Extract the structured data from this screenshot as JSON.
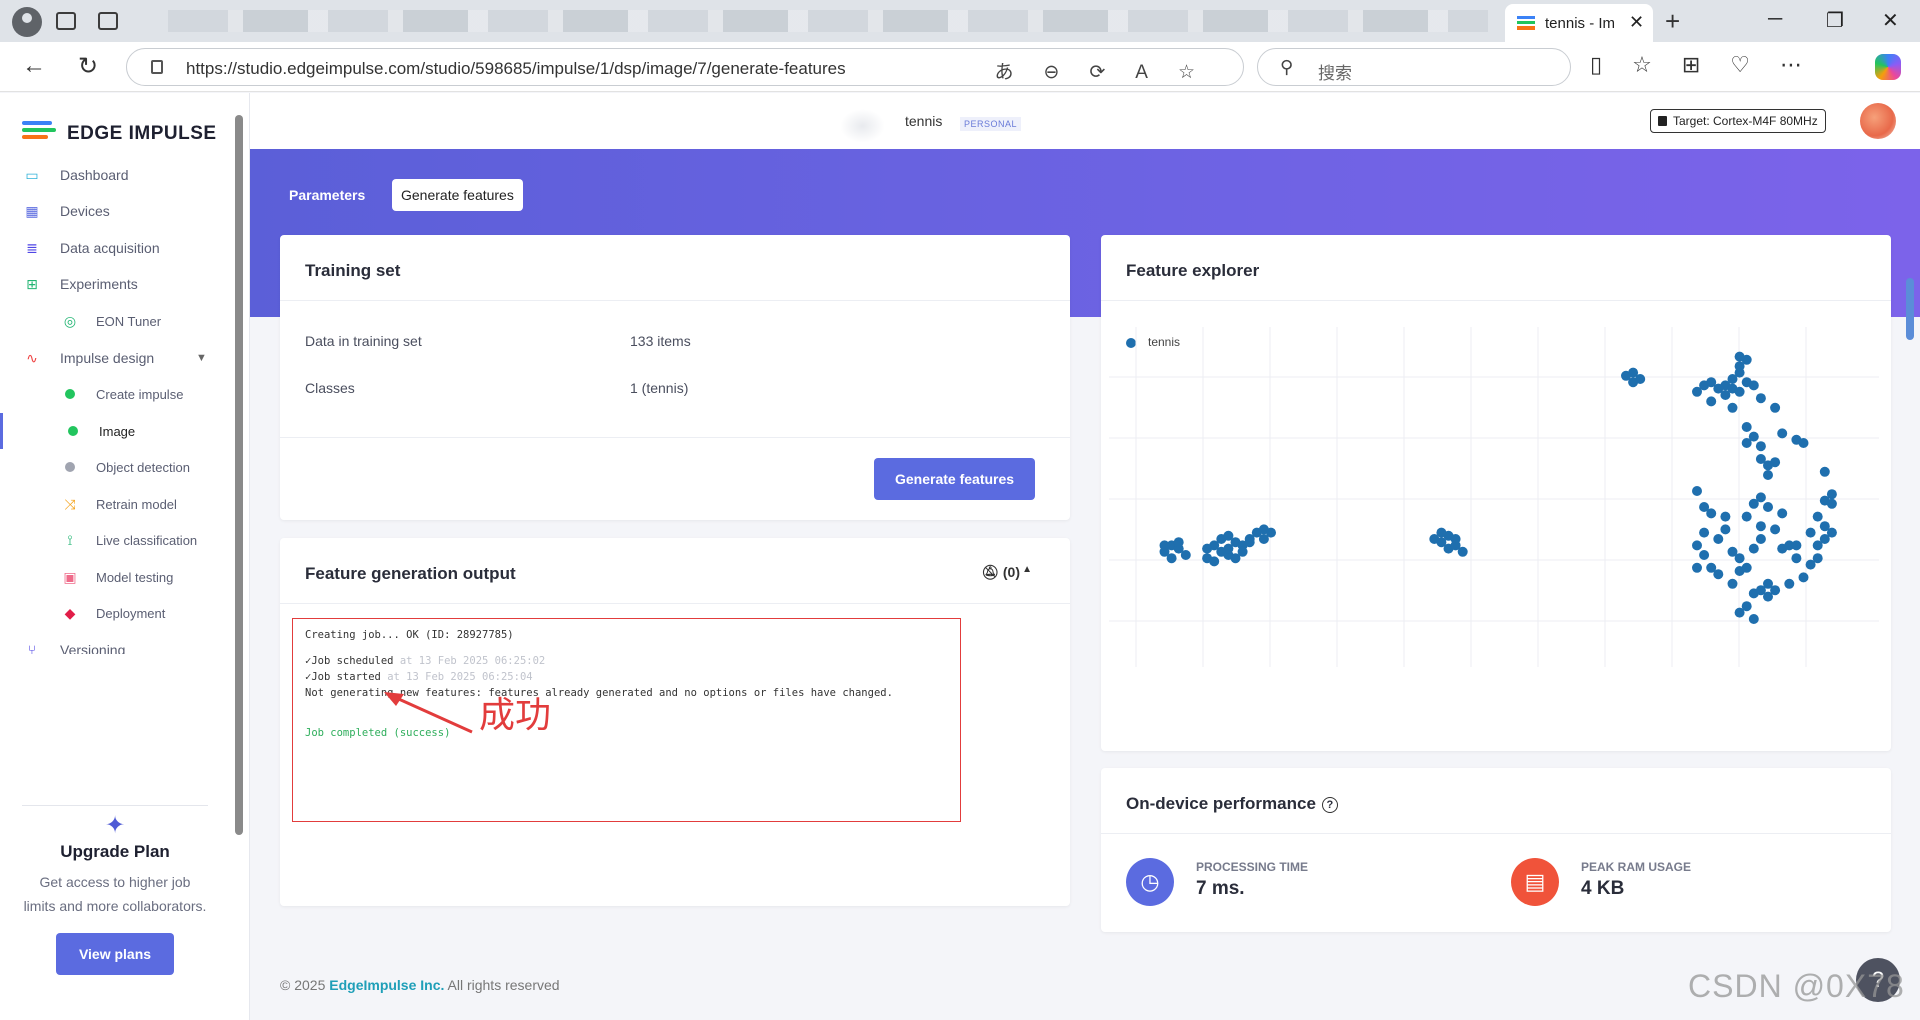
{
  "browser": {
    "active_tab_title": "tennis - Im",
    "url": "https://studio.edgeimpulse.com/studio/598685/impulse/1/dsp/image/7/generate-features",
    "search_placeholder": "搜索"
  },
  "sidebar": {
    "brand": "EDGE IMPULSE",
    "items": [
      {
        "label": "Dashboard",
        "icon": "monitor-icon"
      },
      {
        "label": "Devices",
        "icon": "chip-icon"
      },
      {
        "label": "Data acquisition",
        "icon": "database-icon"
      },
      {
        "label": "Experiments",
        "icon": "table-icon"
      },
      {
        "label": "EON Tuner",
        "icon": "compass-icon"
      },
      {
        "label": "Impulse design",
        "icon": "pulse-icon"
      },
      {
        "label": "Create impulse",
        "icon": "green-dot"
      },
      {
        "label": "Image",
        "icon": "green-dot"
      },
      {
        "label": "Object detection",
        "icon": "gray-dot"
      },
      {
        "label": "Retrain model",
        "icon": "shuffle-icon"
      },
      {
        "label": "Live classification",
        "icon": "classify-icon"
      },
      {
        "label": "Model testing",
        "icon": "flask-icon"
      },
      {
        "label": "Deployment",
        "icon": "box-icon"
      },
      {
        "label": "Versioning",
        "icon": "branch-icon"
      }
    ],
    "upgrade": {
      "title": "Upgrade Plan",
      "description": "Get access to higher job limits and more collaborators.",
      "button": "View plans"
    }
  },
  "topbar": {
    "project_name": "tennis",
    "project_badge": "PERSONAL",
    "target": "Target: Cortex-M4F 80MHz"
  },
  "tabs": {
    "parameters": "Parameters",
    "generate_features": "Generate features"
  },
  "training_set": {
    "title": "Training set",
    "rows": [
      {
        "key": "Data in training set",
        "value": "133 items"
      },
      {
        "key": "Classes",
        "value": "1 (tennis)"
      }
    ],
    "button": "Generate features"
  },
  "output": {
    "title": "Feature generation output",
    "notifications": "(0)",
    "log": {
      "line1": "Creating job... OK (ID: 28927785)",
      "line2_label": "Job scheduled",
      "line2_time": "at 13 Feb 2025 06:25:02",
      "line3_label": "Job started",
      "line3_time": "at 13 Feb 2025 06:25:04",
      "line4": "Not generating new features: features already generated and no options or files have changed.",
      "line5": "Job completed (success)"
    },
    "annotation": "成功"
  },
  "feature_explorer": {
    "title": "Feature explorer",
    "legend": "tennis",
    "color": "#1f6fae"
  },
  "chart_data": {
    "type": "scatter",
    "title": "",
    "xlabel": "",
    "ylabel": "",
    "grid": true,
    "legend_placement": "top-left",
    "series": [
      {
        "name": "tennis",
        "points": [
          [
            0.05,
            0.64
          ],
          [
            0.06,
            0.62
          ],
          [
            0.07,
            0.63
          ],
          [
            0.06,
            0.66
          ],
          [
            0.08,
            0.65
          ],
          [
            0.07,
            0.61
          ],
          [
            0.05,
            0.62
          ],
          [
            0.11,
            0.66
          ],
          [
            0.12,
            0.67
          ],
          [
            0.13,
            0.64
          ],
          [
            0.14,
            0.65
          ],
          [
            0.15,
            0.66
          ],
          [
            0.12,
            0.62
          ],
          [
            0.13,
            0.6
          ],
          [
            0.14,
            0.59
          ],
          [
            0.15,
            0.61
          ],
          [
            0.16,
            0.62
          ],
          [
            0.17,
            0.6
          ],
          [
            0.18,
            0.58
          ],
          [
            0.17,
            0.61
          ],
          [
            0.19,
            0.57
          ],
          [
            0.2,
            0.58
          ],
          [
            0.19,
            0.6
          ],
          [
            0.11,
            0.63
          ],
          [
            0.14,
            0.63
          ],
          [
            0.16,
            0.64
          ],
          [
            0.44,
            0.61
          ],
          [
            0.45,
            0.63
          ],
          [
            0.46,
            0.62
          ],
          [
            0.45,
            0.59
          ],
          [
            0.44,
            0.58
          ],
          [
            0.46,
            0.6
          ],
          [
            0.47,
            0.64
          ],
          [
            0.43,
            0.6
          ],
          [
            0.7,
            0.09
          ],
          [
            0.71,
            0.11
          ],
          [
            0.72,
            0.1
          ],
          [
            0.71,
            0.08
          ],
          [
            0.86,
            0.08
          ],
          [
            0.86,
            0.06
          ],
          [
            0.87,
            0.04
          ],
          [
            0.86,
            0.03
          ],
          [
            0.85,
            0.1
          ],
          [
            0.84,
            0.12
          ],
          [
            0.83,
            0.13
          ],
          [
            0.84,
            0.15
          ],
          [
            0.85,
            0.13
          ],
          [
            0.86,
            0.14
          ],
          [
            0.87,
            0.11
          ],
          [
            0.88,
            0.12
          ],
          [
            0.89,
            0.16
          ],
          [
            0.85,
            0.19
          ],
          [
            0.82,
            0.17
          ],
          [
            0.8,
            0.14
          ],
          [
            0.81,
            0.12
          ],
          [
            0.82,
            0.11
          ],
          [
            0.91,
            0.19
          ],
          [
            0.87,
            0.25
          ],
          [
            0.88,
            0.28
          ],
          [
            0.87,
            0.3
          ],
          [
            0.89,
            0.31
          ],
          [
            0.92,
            0.27
          ],
          [
            0.94,
            0.29
          ],
          [
            0.95,
            0.3
          ],
          [
            0.89,
            0.35
          ],
          [
            0.9,
            0.37
          ],
          [
            0.91,
            0.36
          ],
          [
            0.9,
            0.4
          ],
          [
            0.98,
            0.39
          ],
          [
            0.99,
            0.46
          ],
          [
            0.98,
            0.48
          ],
          [
            0.99,
            0.49
          ],
          [
            0.97,
            0.53
          ],
          [
            0.98,
            0.56
          ],
          [
            0.99,
            0.58
          ],
          [
            0.98,
            0.6
          ],
          [
            0.97,
            0.62
          ],
          [
            0.96,
            0.58
          ],
          [
            0.97,
            0.66
          ],
          [
            0.96,
            0.68
          ],
          [
            0.94,
            0.66
          ],
          [
            0.95,
            0.72
          ],
          [
            0.93,
            0.74
          ],
          [
            0.8,
            0.45
          ],
          [
            0.81,
            0.5
          ],
          [
            0.82,
            0.52
          ],
          [
            0.84,
            0.53
          ],
          [
            0.84,
            0.57
          ],
          [
            0.83,
            0.6
          ],
          [
            0.8,
            0.62
          ],
          [
            0.81,
            0.65
          ],
          [
            0.82,
            0.69
          ],
          [
            0.83,
            0.71
          ],
          [
            0.85,
            0.64
          ],
          [
            0.86,
            0.66
          ],
          [
            0.86,
            0.7
          ],
          [
            0.85,
            0.74
          ],
          [
            0.88,
            0.49
          ],
          [
            0.89,
            0.47
          ],
          [
            0.9,
            0.5
          ],
          [
            0.92,
            0.52
          ],
          [
            0.91,
            0.57
          ],
          [
            0.89,
            0.6
          ],
          [
            0.88,
            0.63
          ],
          [
            0.87,
            0.69
          ],
          [
            0.88,
            0.77
          ],
          [
            0.89,
            0.76
          ],
          [
            0.9,
            0.74
          ],
          [
            0.91,
            0.76
          ],
          [
            0.92,
            0.63
          ],
          [
            0.93,
            0.62
          ],
          [
            0.94,
            0.62
          ],
          [
            0.86,
            0.83
          ],
          [
            0.87,
            0.81
          ],
          [
            0.88,
            0.85
          ],
          [
            0.9,
            0.78
          ],
          [
            0.87,
            0.53
          ],
          [
            0.89,
            0.56
          ],
          [
            0.8,
            0.69
          ],
          [
            0.81,
            0.58
          ]
        ]
      }
    ]
  },
  "performance": {
    "title": "On-device performance",
    "processing_label": "PROCESSING TIME",
    "processing_value": "7 ms.",
    "ram_label": "PEAK RAM USAGE",
    "ram_value": "4 KB"
  },
  "footer": {
    "copyright": "© 2025",
    "company": "EdgeImpulse Inc.",
    "rights": "All rights reserved"
  },
  "watermark": "CSDN @0X78"
}
